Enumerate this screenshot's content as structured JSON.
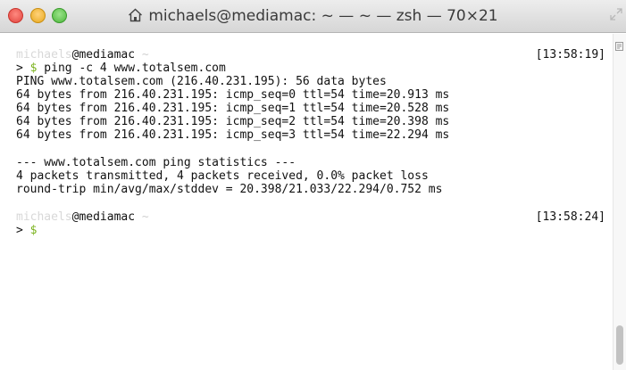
{
  "window": {
    "title": "michaels@mediamac: ~ — ~ — zsh — 70×21",
    "icons": {
      "title": "home-icon",
      "fullscreen": "fullscreen-icon"
    },
    "colors": {
      "close": "#e0443e",
      "minimize": "#e8a91f",
      "zoom": "#4db73c",
      "prompt_dollar": "#7ab21c"
    }
  },
  "terminal": {
    "prompt1": {
      "user": "michaels",
      "host": "@mediamac",
      "tilde": " ~",
      "timestamp": "[13:58:19]"
    },
    "command1": {
      "arrow": "> ",
      "dollar": "$",
      "text": " ping -c 4 www.totalsem.com"
    },
    "output": [
      "PING www.totalsem.com (216.40.231.195): 56 data bytes",
      "64 bytes from 216.40.231.195: icmp_seq=0 ttl=54 time=20.913 ms",
      "64 bytes from 216.40.231.195: icmp_seq=1 ttl=54 time=20.528 ms",
      "64 bytes from 216.40.231.195: icmp_seq=2 ttl=54 time=20.398 ms",
      "64 bytes from 216.40.231.195: icmp_seq=3 ttl=54 time=22.294 ms"
    ],
    "stats": [
      "--- www.totalsem.com ping statistics ---",
      "4 packets transmitted, 4 packets received, 0.0% packet loss",
      "round-trip min/avg/max/stddev = 20.398/21.033/22.294/0.752 ms"
    ],
    "prompt2": {
      "user": "michaels",
      "host": "@mediamac",
      "tilde": " ~",
      "timestamp": "[13:58:24]"
    },
    "command2": {
      "arrow": "> ",
      "dollar": "$"
    }
  }
}
